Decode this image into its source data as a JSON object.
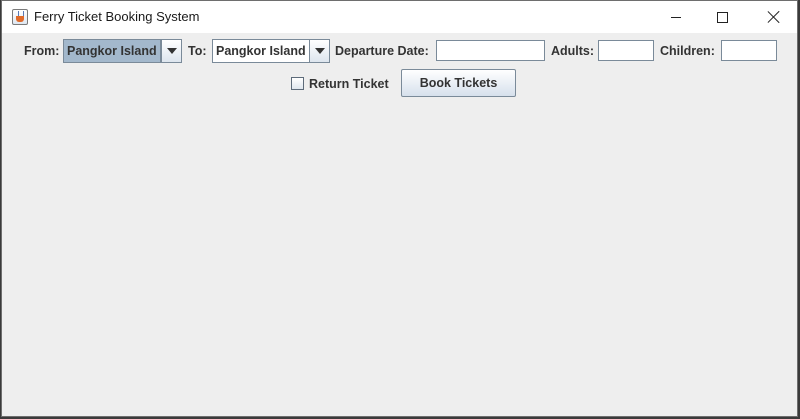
{
  "window": {
    "title": "Ferry Ticket Booking System"
  },
  "form": {
    "from_label": "From:",
    "from_value": "Pangkor Island",
    "to_label": "To:",
    "to_value": "Pangkor Island",
    "departure_label": "Departure Date:",
    "departure_value": "",
    "adults_label": "Adults:",
    "adults_value": "",
    "children_label": "Children:",
    "children_value": "",
    "return_label": "Return Ticket",
    "return_checked": false,
    "book_label": "Book Tickets"
  },
  "icons": {
    "app": "java-cup-icon",
    "minimize": "minimize-icon",
    "maximize": "maximize-icon",
    "close": "close-icon",
    "dropdown": "chevron-down-icon"
  },
  "colors": {
    "background": "#eeeeee",
    "combo_selected": "#a3b8cc",
    "text": "#333333"
  }
}
